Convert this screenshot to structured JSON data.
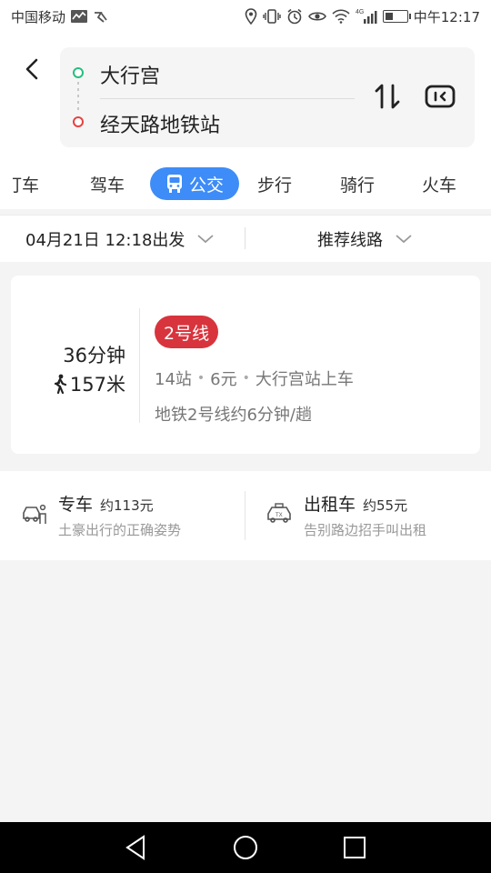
{
  "status_bar": {
    "carrier": "中国移动",
    "network": "4G",
    "time": "中午12:17",
    "battery_level": 0.35
  },
  "header": {
    "origin": "大行宫",
    "destination": "经天路地铁站"
  },
  "tabs": [
    {
      "label": "打车",
      "active": false
    },
    {
      "label": "驾车",
      "active": false
    },
    {
      "label": "公交",
      "active": true
    },
    {
      "label": "步行",
      "active": false
    },
    {
      "label": "骑行",
      "active": false
    },
    {
      "label": "火车",
      "active": false
    }
  ],
  "filter": {
    "departure": "04月21日 12:18出发",
    "preference": "推荐线路"
  },
  "route": {
    "duration": "36分钟",
    "walk_distance": "157米",
    "line": "2号线",
    "line_color": "#d8343d",
    "stops": "14站",
    "fare": "6元",
    "board_at": "大行宫站上车",
    "description": "地铁2号线约6分钟/趟"
  },
  "services": [
    {
      "title": "专车",
      "price": "约113元",
      "subtitle": "土豪出行的正确姿势",
      "icon": "car-icon"
    },
    {
      "title": "出租车",
      "price": "约55元",
      "subtitle": "告别路边招手叫出租",
      "icon": "taxi-icon"
    }
  ],
  "colors": {
    "accent": "#3e8cf7",
    "origin_dot": "#25c07b",
    "destination_dot": "#e64340"
  }
}
